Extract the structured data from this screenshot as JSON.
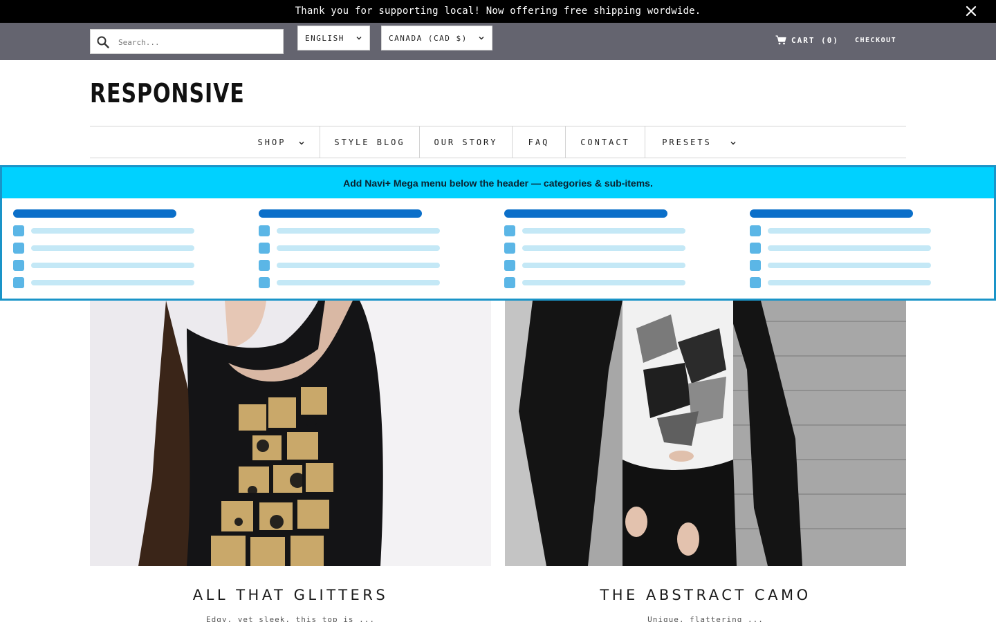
{
  "announcement": {
    "text": "Thank you for supporting local! Now offering free shipping wordwide.",
    "close_icon": "close-icon"
  },
  "utility": {
    "search_placeholder": "Search...",
    "language": "ENGLISH",
    "currency": "CANADA (CAD $)",
    "cart_label": "CART (0)",
    "checkout_label": "CHECKOUT"
  },
  "logo": "RESPONSIVE",
  "nav": {
    "items": [
      {
        "label": "SHOP",
        "dropdown": true
      },
      {
        "label": "STYLE BLOG",
        "dropdown": false
      },
      {
        "label": "OUR STORY",
        "dropdown": false
      },
      {
        "label": "FAQ",
        "dropdown": false
      },
      {
        "label": "CONTACT",
        "dropdown": false
      },
      {
        "label": "PRESETS",
        "dropdown": true
      }
    ]
  },
  "mega_menu": {
    "title": "Add Navi+ Mega menu below the header — categories & sub-items.",
    "columns": 4,
    "sub_items_per_column": 4
  },
  "products": [
    {
      "title": "ALL THAT GLITTERS",
      "description": "Edgy, yet sleek, this top is ..."
    },
    {
      "title": "THE ABSTRACT CAMO",
      "description": "Unique, flattering ..."
    }
  ],
  "colors": {
    "announcement_bg": "#000000",
    "utility_bg": "#64646f",
    "mega_header_bg": "#00d1ff",
    "mega_border": "#1a94c8",
    "mega_category": "#0b6fc9",
    "mega_subitem_icon": "#5bb6e6",
    "mega_subitem_line": "#c4e8f6"
  }
}
